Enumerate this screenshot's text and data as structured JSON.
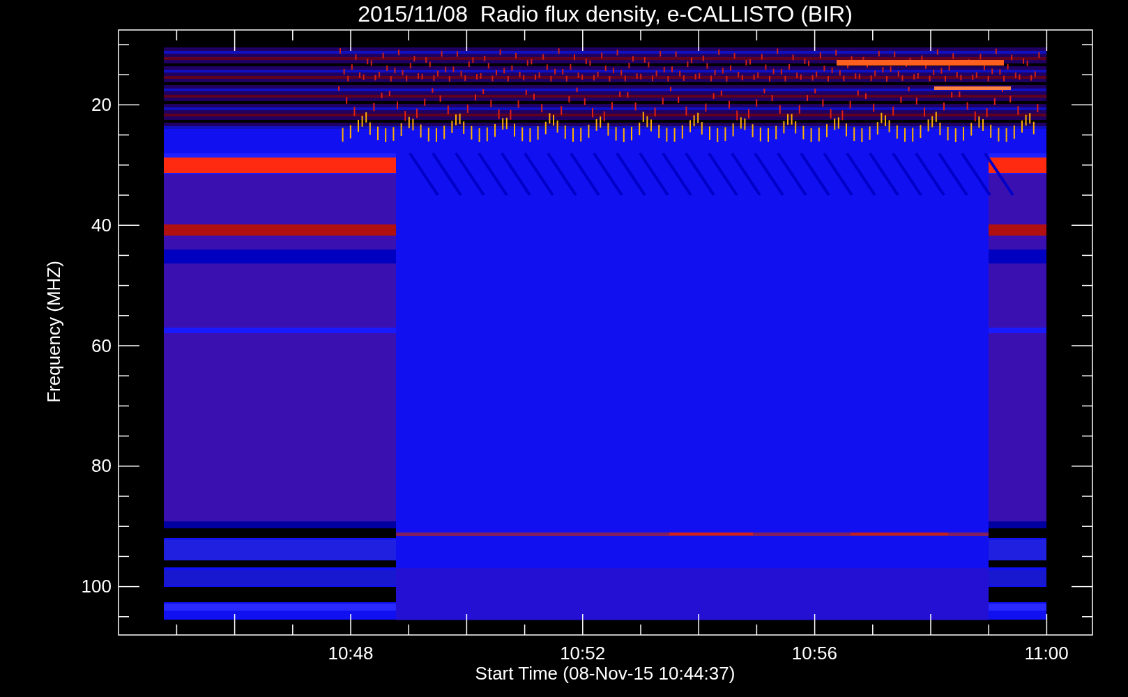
{
  "title": "2015/11/08  Radio flux density, e-CALLISTO (BIR)",
  "y_axis": {
    "label": "Frequency (MHZ)",
    "ticks": [
      "20",
      "40",
      "60",
      "80",
      "100"
    ]
  },
  "x_axis": {
    "label": "Start Time (08-Nov-15 10:44:37)",
    "ticks": [
      "10:48",
      "10:52",
      "10:56",
      "11:00"
    ]
  }
}
